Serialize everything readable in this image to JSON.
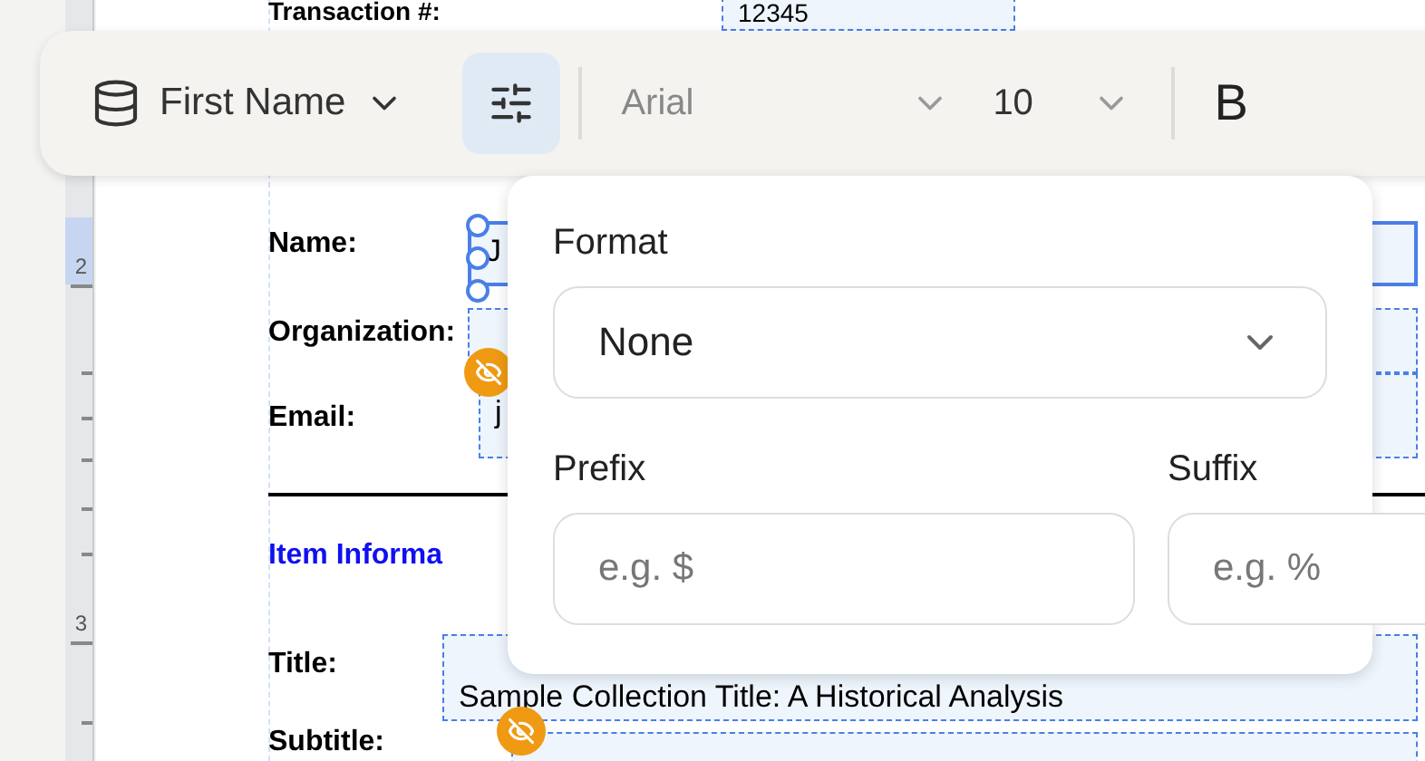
{
  "ruler": {
    "marks": [
      {
        "label": "2",
        "selected": true
      },
      {
        "label": "3",
        "selected": false
      }
    ]
  },
  "document": {
    "fields": [
      {
        "label": "Transaction #:",
        "value": "12345",
        "badge": false,
        "selected": false
      },
      {
        "label": "Name:",
        "value": "J",
        "badge": false,
        "selected": true
      },
      {
        "label": "Organization:",
        "badge": false,
        "selected": false
      },
      {
        "label": "Email:",
        "value": "j",
        "badge": true,
        "selected": false
      }
    ],
    "section_heading": "Item Informa",
    "item_fields": [
      {
        "label": "Title:",
        "value": "Sample Collection Title: A Historical Analysis",
        "badge": false,
        "selected": false
      },
      {
        "label": "Subtitle:",
        "badge": true,
        "selected": false
      }
    ]
  },
  "toolbar": {
    "field": "First Name",
    "settings_active": true,
    "font": "Arial",
    "size": "10",
    "bold_label": "B"
  },
  "popover": {
    "format_label": "Format",
    "format_value": "None",
    "prefix_label": "Prefix",
    "prefix_placeholder": "e.g. $",
    "suffix_label": "Suffix",
    "suffix_placeholder": "e.g. %"
  }
}
